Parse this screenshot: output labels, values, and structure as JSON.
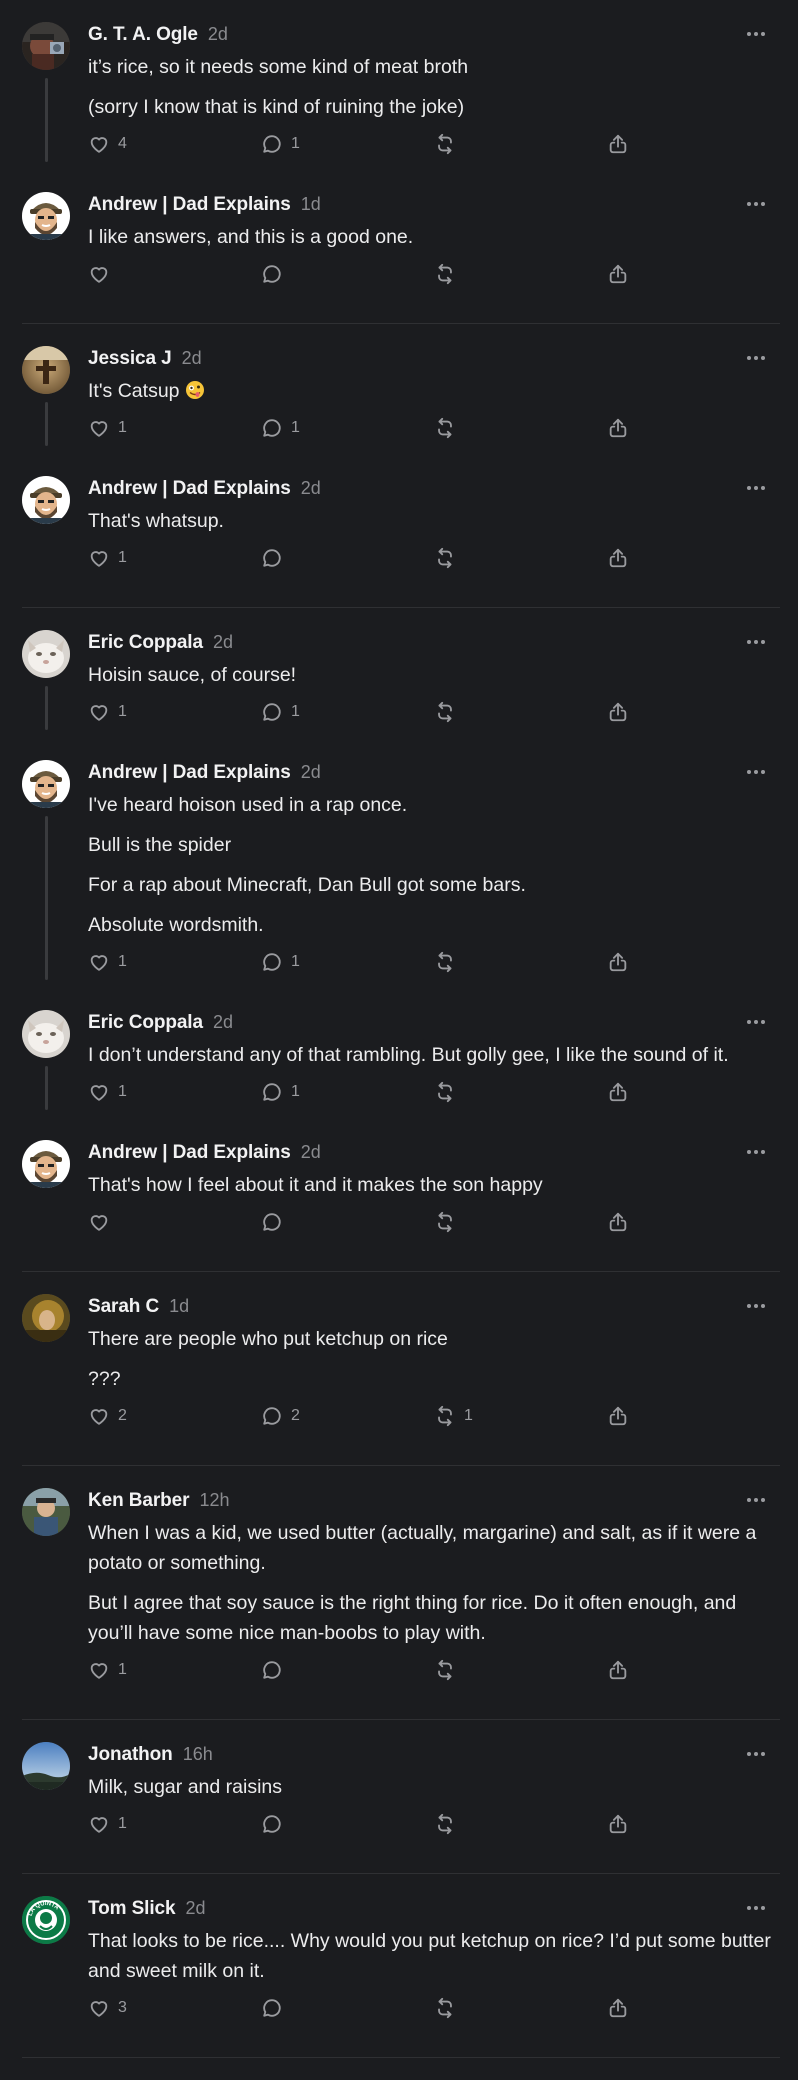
{
  "posts": [
    {
      "name": "G. T. A. Ogle",
      "time": "2d",
      "paragraphs": [
        "it’s rice, so it needs some kind of meat broth",
        "(sorry I know that is kind of ruining the joke)"
      ],
      "likes": "4",
      "replies": "1",
      "reposts": "",
      "avatar": "avatar-ogle",
      "thread_below": true,
      "divider": false
    },
    {
      "name": "Andrew | Dad Explains",
      "time": "1d",
      "paragraphs": [
        "I like answers, and this is a good one."
      ],
      "likes": "",
      "replies": "",
      "reposts": "",
      "avatar": "avatar-andrew",
      "thread_below": false,
      "divider": true
    },
    {
      "name": "Jessica J",
      "time": "2d",
      "paragraphs": [
        "It's Catsup "
      ],
      "emoji_after": "zany-face",
      "likes": "1",
      "replies": "1",
      "reposts": "",
      "avatar": "avatar-jessica",
      "thread_below": true,
      "divider": false
    },
    {
      "name": "Andrew | Dad Explains",
      "time": "2d",
      "paragraphs": [
        "That's whatsup."
      ],
      "likes": "1",
      "replies": "",
      "reposts": "",
      "avatar": "avatar-andrew",
      "thread_below": false,
      "divider": true
    },
    {
      "name": "Eric Coppala",
      "time": "2d",
      "paragraphs": [
        "Hoisin sauce, of course!"
      ],
      "likes": "1",
      "replies": "1",
      "reposts": "",
      "avatar": "avatar-eric",
      "thread_below": true,
      "divider": false
    },
    {
      "name": "Andrew | Dad Explains",
      "time": "2d",
      "paragraphs": [
        "I've heard hoison used in a rap once.",
        "Bull is the spider",
        "For a rap about Minecraft, Dan Bull got some bars.",
        "Absolute wordsmith."
      ],
      "likes": "1",
      "replies": "1",
      "reposts": "",
      "avatar": "avatar-andrew",
      "thread_below": true,
      "divider": false
    },
    {
      "name": "Eric Coppala",
      "time": "2d",
      "paragraphs": [
        "I don’t understand any of that rambling. But golly gee, I like the sound of it."
      ],
      "likes": "1",
      "replies": "1",
      "reposts": "",
      "avatar": "avatar-eric",
      "thread_below": true,
      "divider": false
    },
    {
      "name": "Andrew | Dad Explains",
      "time": "2d",
      "paragraphs": [
        "That's how I feel about it and it makes the son happy"
      ],
      "likes": "",
      "replies": "",
      "reposts": "",
      "avatar": "avatar-andrew",
      "thread_below": false,
      "divider": true
    },
    {
      "name": "Sarah C",
      "time": "1d",
      "paragraphs": [
        "There are people who put ketchup on rice",
        "???"
      ],
      "likes": "2",
      "replies": "2",
      "reposts": "1",
      "avatar": "avatar-sarah",
      "thread_below": false,
      "divider": true
    },
    {
      "name": "Ken Barber",
      "time": "12h",
      "paragraphs": [
        "When I was a kid, we used butter (actually, margarine) and salt, as if it were a potato or something.",
        "But I agree that soy sauce is the right thing for rice. Do it often enough, and you’ll have some nice man-boobs to play with."
      ],
      "likes": "1",
      "replies": "",
      "reposts": "",
      "avatar": "avatar-ken",
      "thread_below": false,
      "divider": true
    },
    {
      "name": "Jonathon",
      "time": "16h",
      "paragraphs": [
        "Milk, sugar and raisins"
      ],
      "likes": "1",
      "replies": "",
      "reposts": "",
      "avatar": "avatar-jonathon",
      "thread_below": false,
      "divider": true
    },
    {
      "name": "Tom Slick",
      "time": "2d",
      "paragraphs": [
        "That looks to be rice.... Why would you put ketchup on rice? I’d put some butter and sweet milk on it."
      ],
      "likes": "3",
      "replies": "",
      "reposts": "",
      "avatar": "avatar-tom",
      "thread_below": false,
      "divider": true
    }
  ],
  "avatar_logo_text": "LA QUINTA COFFEE",
  "colors": {
    "background": "#1b1c1f",
    "text": "#ececed",
    "muted": "#8a8b8f",
    "divider": "#2f3033",
    "thread_line": "#3a3b3e"
  }
}
